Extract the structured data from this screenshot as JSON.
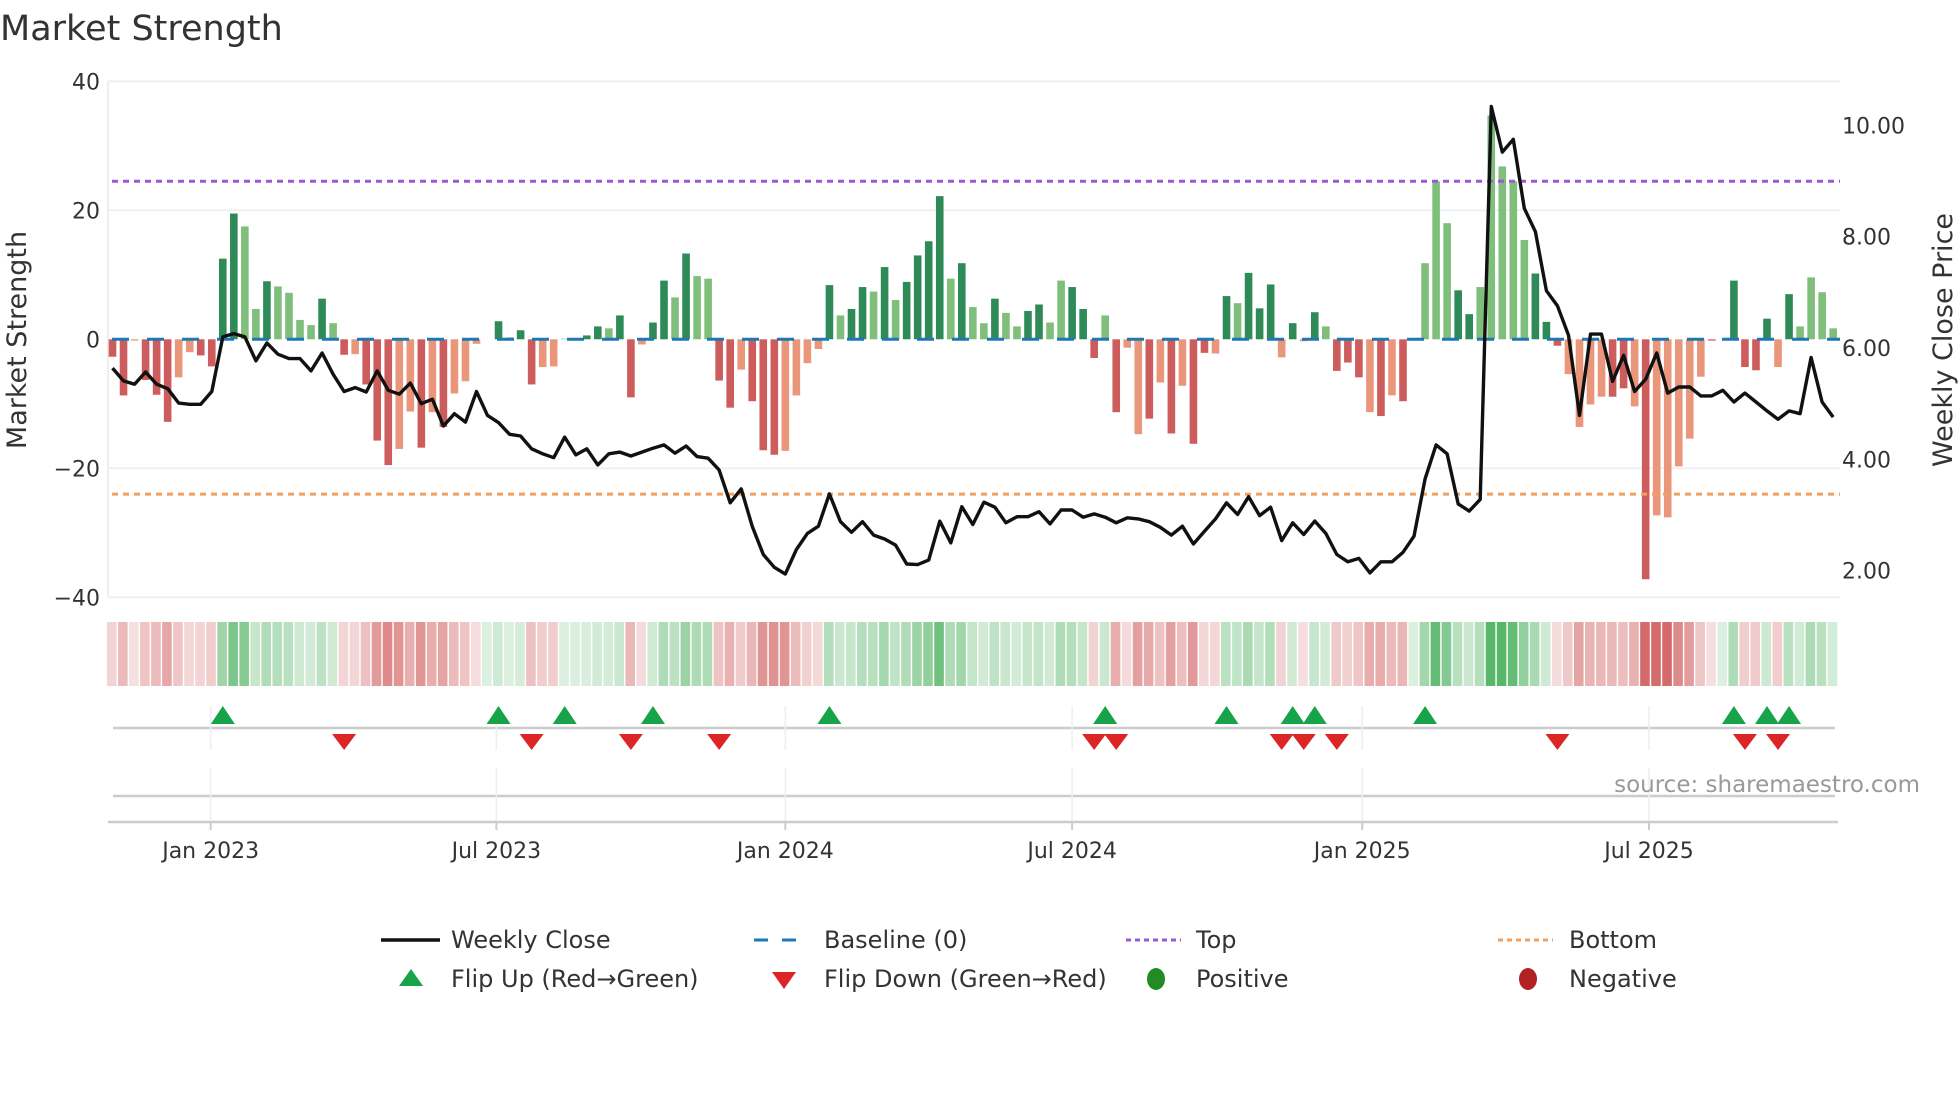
{
  "chart_data": {
    "type": "bar",
    "title": "Market Strength",
    "ylabel": "Market Strength",
    "y2label": "Weekly Close Price",
    "ylim": [
      -40,
      40
    ],
    "y2lim": [
      1.0,
      10.8
    ],
    "yticks": [
      40,
      20,
      0,
      -20,
      -40
    ],
    "yticklabels": [
      "40",
      "20",
      "0",
      "−20",
      "−40"
    ],
    "y2ticks": [
      10,
      8,
      6,
      4,
      2
    ],
    "y2ticklabels": [
      "10.00",
      "8.00",
      "6.00",
      "4.00",
      "2.00"
    ],
    "grid": true,
    "top_level": 24.5,
    "bottom_level": -24,
    "xticks": [
      {
        "week": 8.9,
        "label": "Jan 2023"
      },
      {
        "week": 34.8,
        "label": "Jul 2023"
      },
      {
        "week": 61,
        "label": "Jan 2024"
      },
      {
        "week": 87,
        "label": "Jul 2024"
      },
      {
        "week": 113.3,
        "label": "Jan 2025"
      },
      {
        "week": 139.3,
        "label": "Jul 2025"
      }
    ],
    "strength": [
      -2.7,
      -8.7,
      -0.2,
      -6.3,
      -8.6,
      -12.8,
      -5.9,
      -2,
      -2.5,
      -4.2,
      12.5,
      19.5,
      17.5,
      4.7,
      9,
      8.2,
      7.2,
      3,
      2.2,
      6.3,
      2.5,
      -2.4,
      -2.3,
      -7,
      -15.7,
      -19.5,
      -17,
      -11.2,
      -16.8,
      -11.3,
      -13.6,
      -8.4,
      -6.5,
      -0.7,
      0,
      2.8,
      0.3,
      1.4,
      -7,
      -4.3,
      -4.2,
      0.1,
      0.2,
      0.6,
      2,
      1.7,
      3.7,
      -9,
      -0.8,
      2.6,
      9.1,
      6.5,
      13.3,
      9.8,
      9.4,
      -6.4,
      -10.6,
      -4.7,
      -9.6,
      -17.2,
      -17.9,
      -17.3,
      -8.7,
      -3.7,
      -1.5,
      8.4,
      3.7,
      4.7,
      8.1,
      7.4,
      11.2,
      6.1,
      8.9,
      13,
      15.2,
      22.2,
      9.4,
      11.8,
      5,
      2.5,
      6.3,
      4.1,
      2,
      4.4,
      5.4,
      2.6,
      9.1,
      8.1,
      4.7,
      -2.9,
      3.7,
      -11.3,
      -1.3,
      -14.7,
      -12.3,
      -6.7,
      -14.6,
      -7.2,
      -16.2,
      -2.1,
      -2.2,
      6.7,
      5.6,
      10.3,
      4.8,
      8.5,
      -2.8,
      2.5,
      -0.3,
      4.2,
      2,
      -4.9,
      -3.6,
      -5.9,
      -11.3,
      -11.9,
      -8.7,
      -9.6,
      0,
      11.8,
      24.5,
      18,
      7.6,
      3.9,
      8.1,
      34.7,
      26.8,
      24.5,
      15.4,
      10.2,
      2.7,
      -1,
      -5.4,
      -13.6,
      -10.1,
      -8.9,
      -8.9,
      -7.6,
      -10.4,
      -37.2,
      -27.3,
      -27.6,
      -19.7,
      -15.4,
      -5.8,
      -0.2,
      0,
      9.1,
      -4.3,
      -4.8,
      3.2,
      -4.3,
      7,
      2,
      9.6,
      7.3,
      1.7
    ],
    "shade": "DDLDDDLLDDDDLLDLLLLDLDLDDDLLDLDLLLLDLDDLLLLDDLDDLDDLDLLDDLDDDLLLLDLDDLDLDDDDLDLLDLLDDLLDDDLDLLDLDLDDLDLDDDLDLDLDDDLDLDDLLLDDLLLLLDDDLLLLDDLDLLLLLDDDDDDLDLL",
    "weekly_close": [
      5.64,
      5.41,
      5.35,
      5.57,
      5.35,
      5.27,
      5.01,
      4.99,
      4.99,
      5.22,
      6.2,
      6.26,
      6.2,
      5.77,
      6.09,
      5.89,
      5.81,
      5.81,
      5.59,
      5.91,
      5.53,
      5.22,
      5.29,
      5.21,
      5.59,
      5.24,
      5.17,
      5.37,
      5.0,
      5.08,
      4.6,
      4.82,
      4.67,
      5.22,
      4.79,
      4.66,
      4.45,
      4.42,
      4.19,
      4.1,
      4.03,
      4.4,
      4.08,
      4.19,
      3.9,
      4.1,
      4.13,
      4.06,
      4.13,
      4.2,
      4.26,
      4.11,
      4.24,
      4.05,
      4.02,
      3.81,
      3.22,
      3.47,
      2.8,
      2.29,
      2.06,
      1.94,
      2.38,
      2.67,
      2.8,
      3.38,
      2.88,
      2.69,
      2.88,
      2.64,
      2.57,
      2.46,
      2.12,
      2.11,
      2.19,
      2.89,
      2.5,
      3.15,
      2.83,
      3.23,
      3.14,
      2.86,
      2.97,
      2.97,
      3.06,
      2.84,
      3.09,
      3.09,
      2.96,
      3.02,
      2.96,
      2.86,
      2.95,
      2.93,
      2.88,
      2.78,
      2.64,
      2.8,
      2.48,
      2.71,
      2.93,
      3.22,
      3.01,
      3.33,
      2.99,
      3.14,
      2.54,
      2.86,
      2.65,
      2.89,
      2.67,
      2.29,
      2.16,
      2.22,
      1.96,
      2.16,
      2.16,
      2.33,
      2.62,
      3.65,
      4.26,
      4.1,
      3.2,
      3.07,
      3.28,
      10.34,
      9.52,
      9.75,
      8.51,
      8.09,
      7.03,
      6.76,
      6.23,
      4.79,
      6.25,
      6.25,
      5.4,
      5.87,
      5.22,
      5.44,
      5.91,
      5.19,
      5.3,
      5.3,
      5.14,
      5.14,
      5.24,
      5.03,
      5.19,
      5.03,
      4.87,
      4.72,
      4.87,
      4.82,
      5.83,
      5.03,
      4.76
    ],
    "flip_up_weeks": [
      10,
      35,
      41,
      49,
      65,
      90,
      101,
      107,
      109,
      119,
      147,
      150,
      152
    ],
    "flip_down_weeks": [
      21,
      38,
      47,
      55,
      89,
      91,
      106,
      108,
      111,
      131,
      148,
      151
    ],
    "legend": {
      "placement": "bottom",
      "weekly_close": "Weekly Close",
      "baseline": "Baseline (0)",
      "top": "Top",
      "bottom": "Bottom",
      "flip_up": "Flip Up (Red→Green)",
      "flip_down": "Flip Down (Green→Red)",
      "positive": "Positive",
      "negative": "Negative"
    },
    "source": "source: sharemaestro.com",
    "colors": {
      "pos_dark": "#2e8b57",
      "pos_light": "#7fbf7b",
      "neg_dark": "#cd5c5c",
      "neg_light": "#e9967a",
      "baseline": "#1f77b4",
      "top": "#9b59d6",
      "bottom": "#f0a060",
      "flip_up": "#16a34a",
      "flip_down": "#dc2626",
      "positive": "#228b22",
      "negative": "#b22222",
      "line": "#111111"
    }
  }
}
